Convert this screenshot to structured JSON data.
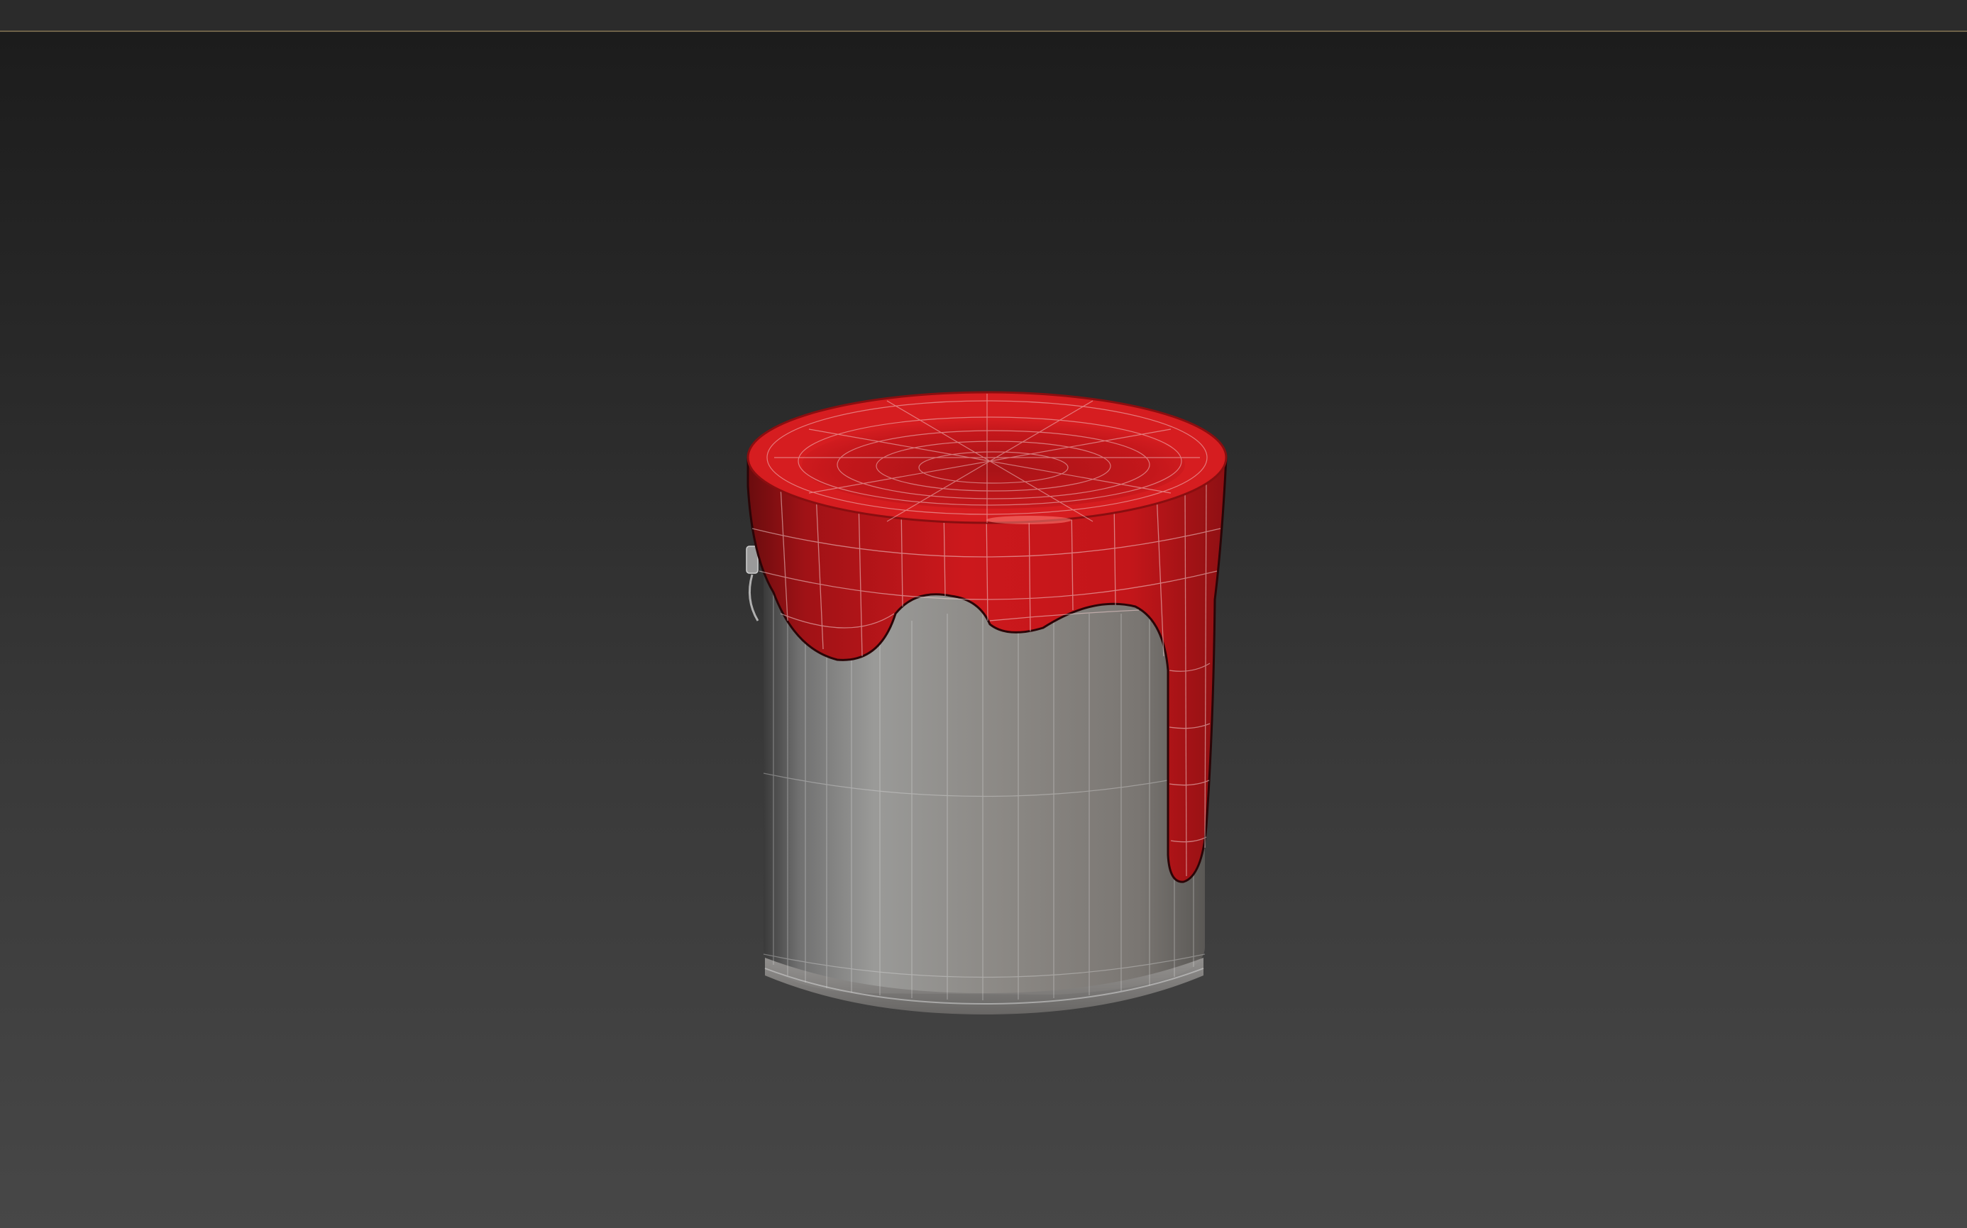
{
  "viewport": {
    "title": "",
    "background_top": "#1c1c1c",
    "background_bottom": "#474747",
    "selection_strip_color": "#6e6148"
  },
  "scene": {
    "object": "paint-can",
    "can_color": "#8a8a86",
    "paint_color": "#c8151a",
    "wireframe_color": "#e6e6e6",
    "wireframe_visible": true
  }
}
